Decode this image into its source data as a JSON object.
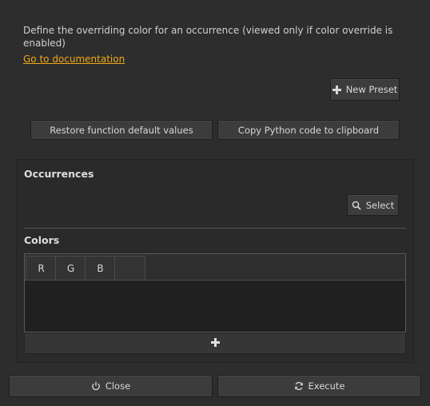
{
  "description": "Define the overriding color for an occurrence (viewed only if color override is enabled)",
  "doc_link": "Go to documentation",
  "buttons": {
    "new_preset": "New Preset",
    "restore_defaults": "Restore function default values",
    "copy_python": "Copy Python code to clipboard",
    "select": "Select",
    "close": "Close",
    "execute": "Execute"
  },
  "occurrences": {
    "title": "Occurrences"
  },
  "colors": {
    "title": "Colors",
    "columns": [
      "R",
      "G",
      "B",
      ""
    ],
    "rows": []
  },
  "icons": {
    "new_preset": "plus-icon",
    "select": "magnifier-icon",
    "add_row": "plus-icon",
    "close": "power-icon",
    "execute": "refresh-icon"
  },
  "accent_color": "#f0a818"
}
